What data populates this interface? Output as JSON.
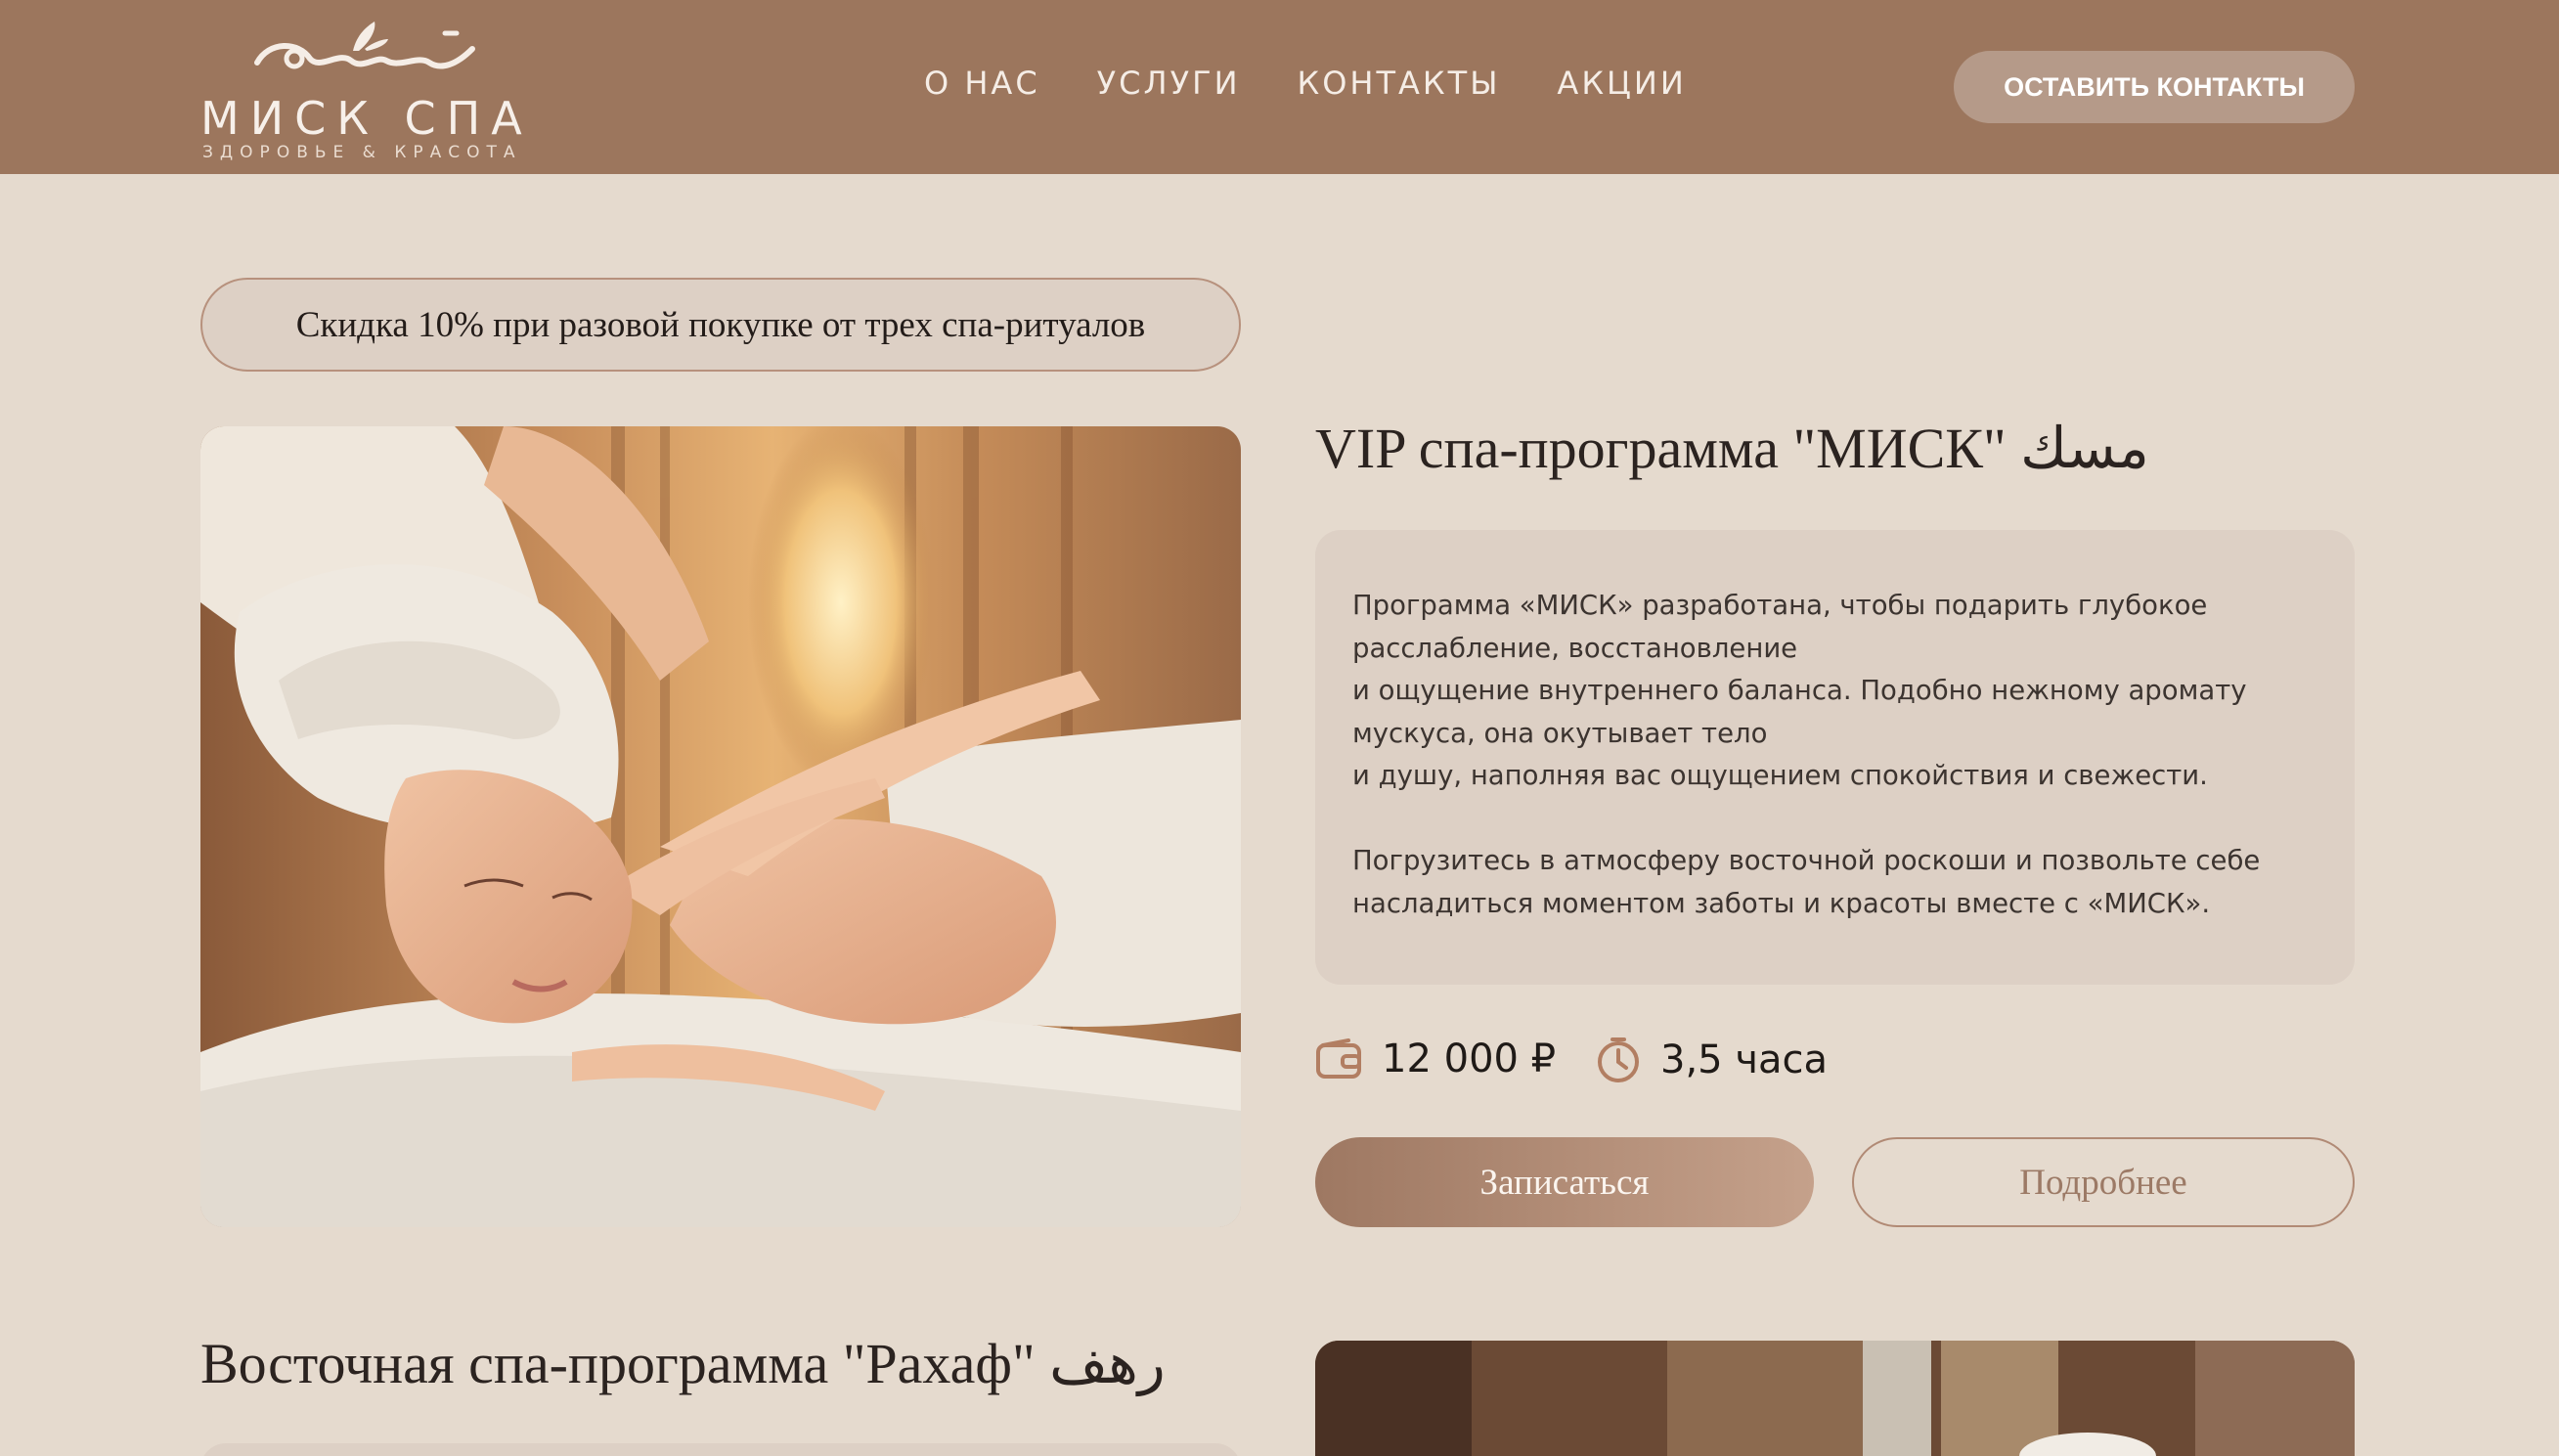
{
  "header": {
    "logo": {
      "arabic": "مِسك",
      "title": "МИСК СПА",
      "subtitle": "ЗДОРОВЬЕ & КРАСОТА"
    },
    "nav": [
      "О НАС",
      "УСЛУГИ",
      "КОНТАКТЫ",
      "АКЦИИ"
    ],
    "cta_label": "ОСТАВИТЬ КОНТАКТЫ"
  },
  "promo": {
    "discount_text": "Скидка 10% при разовой покупке от трех спа-ритуалов"
  },
  "program1": {
    "title": "VIP спа-программа \"МИСК\" مسك",
    "description_lines": [
      "Программа «МИСК» разработана, чтобы подарить глубокое",
      "расслабление, восстановление",
      "и ощущение внутреннего баланса. Подобно нежному аромату",
      "мускуса, она окутывает тело",
      "и душу, наполняя вас ощущением спокойствия и свежести."
    ],
    "description_lines2": [
      "Погрузитесь в атмосферу восточной роскоши и позвольте себе",
      "насладиться моментом заботы и красоты вместе с «МИСК»."
    ],
    "price": "12 000 ₽",
    "duration": "3,5 часа",
    "book_label": "Записаться",
    "more_label": "Подробнее"
  },
  "program2": {
    "title": "Восточная спа-программа \"Рахаф\" رهف"
  },
  "colors": {
    "header_bg": "#9c765d",
    "page_bg": "#e5dace",
    "card_bg": "#ddd0c5",
    "accent": "#a88069"
  }
}
